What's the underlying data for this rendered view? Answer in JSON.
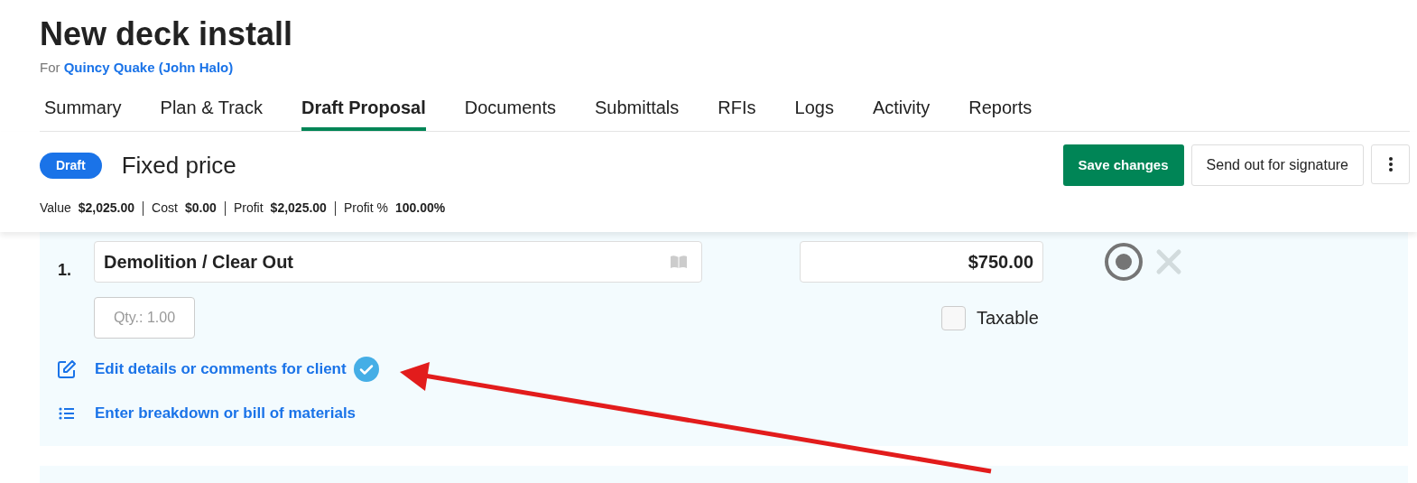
{
  "project": {
    "title": "New deck install",
    "for_label": "For",
    "client": "Quincy Quake (John Halo)"
  },
  "tabs": [
    {
      "label": "Summary",
      "selected": false
    },
    {
      "label": "Plan & Track",
      "selected": false
    },
    {
      "label": "Draft Proposal",
      "selected": true
    },
    {
      "label": "Documents",
      "selected": false
    },
    {
      "label": "Submittals",
      "selected": false
    },
    {
      "label": "RFIs",
      "selected": false
    },
    {
      "label": "Logs",
      "selected": false
    },
    {
      "label": "Activity",
      "selected": false
    },
    {
      "label": "Reports",
      "selected": false
    }
  ],
  "proposal": {
    "status": "Draft",
    "type": "Fixed price",
    "stats": [
      {
        "label": "Value",
        "value": "$2,025.00"
      },
      {
        "label": "Cost",
        "value": "$0.00"
      },
      {
        "label": "Profit",
        "value": "$2,025.00"
      },
      {
        "label": "Profit %",
        "value": "100.00%"
      }
    ]
  },
  "actions": [
    {
      "kind": "primary",
      "label": "Save changes"
    },
    {
      "kind": "secondary",
      "label": "Send out for signature"
    },
    {
      "kind": "more"
    }
  ],
  "line_items": [
    {
      "number": "1.",
      "name": "Demolition / Clear Out",
      "price": "$750.00",
      "quantity_placeholder": "Qty.: 1.00",
      "taxable_label": "Taxable",
      "taxable": false,
      "links": [
        {
          "kind": "details",
          "label": "Edit details or comments for client",
          "done": true
        },
        {
          "kind": "breakdown",
          "label": "Enter breakdown or bill of materials",
          "done": false
        }
      ]
    }
  ],
  "annotations": [
    {
      "kind": "arrow"
    }
  ]
}
